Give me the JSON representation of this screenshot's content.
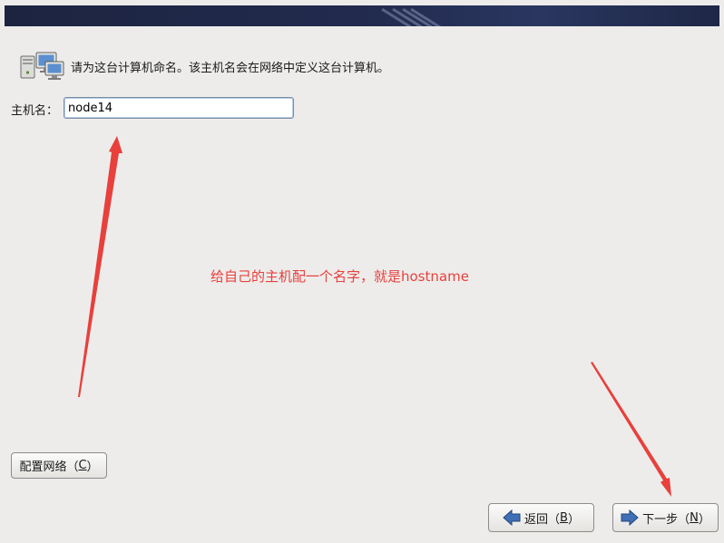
{
  "banner": {
    "title": ""
  },
  "intro": {
    "icon": "network-computers-icon",
    "text": "请为这台计算机命名。该主机名会在网络中定义这台计算机。"
  },
  "hostname": {
    "label": "主机名：",
    "value": "node14",
    "placeholder": ""
  },
  "annotation": {
    "text": "给自己的主机配一个名字，就是hostname",
    "color": "#e8403c"
  },
  "buttons": {
    "configure_network": {
      "prefix": "配置网络（",
      "mnemonic": "C",
      "suffix": "）"
    },
    "back": {
      "icon": "arrow-left-icon",
      "prefix": "返回（",
      "mnemonic": "B",
      "suffix": "）"
    },
    "next": {
      "icon": "arrow-right-icon",
      "prefix": "下一步（",
      "mnemonic": "N",
      "suffix": "）"
    }
  },
  "colors": {
    "background": "#edeceb",
    "banner": "#222b4e",
    "arrow": "#e8403c",
    "button_arrow": "#3f6fb5"
  }
}
